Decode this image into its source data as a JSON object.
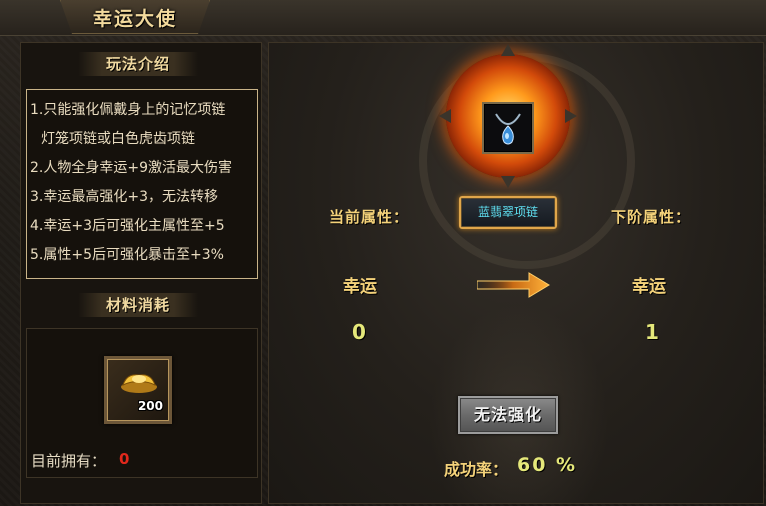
{
  "window": {
    "title": "幸运大使"
  },
  "rules": {
    "header": "玩法介绍",
    "lines": [
      "1.只能强化佩戴身上的记忆项链",
      "灯笼项链或白色虎齿项链",
      "2.人物全身幸运+9激活最大伤害",
      "3.幸运最高强化+3，无法转移",
      "4.幸运+3后可强化主属性至+5",
      "5.属性+5后可强化暴击至+3%"
    ]
  },
  "materials": {
    "header": "材料消耗",
    "item": {
      "icon": "gold-ingot-icon",
      "count": "200"
    },
    "owned_label": "目前拥有：",
    "owned_value": "0"
  },
  "upgrade": {
    "equipped_item": {
      "icon": "blue-necklace-icon",
      "name": "蓝翡翠项链"
    },
    "current_label": "当前属性：",
    "next_label": "下阶属性：",
    "current_stat": {
      "name": "幸运",
      "value": "0"
    },
    "next_stat": {
      "name": "幸运",
      "value": "1"
    },
    "action_button": "无法强化",
    "success_rate_label": "成功率：",
    "success_rate_value": "60 %"
  },
  "colors": {
    "gold_text": "#f4d27a",
    "value_text": "#e5e87a",
    "owned_zero": "#e0281c",
    "item_name": "#5fe0f2"
  }
}
